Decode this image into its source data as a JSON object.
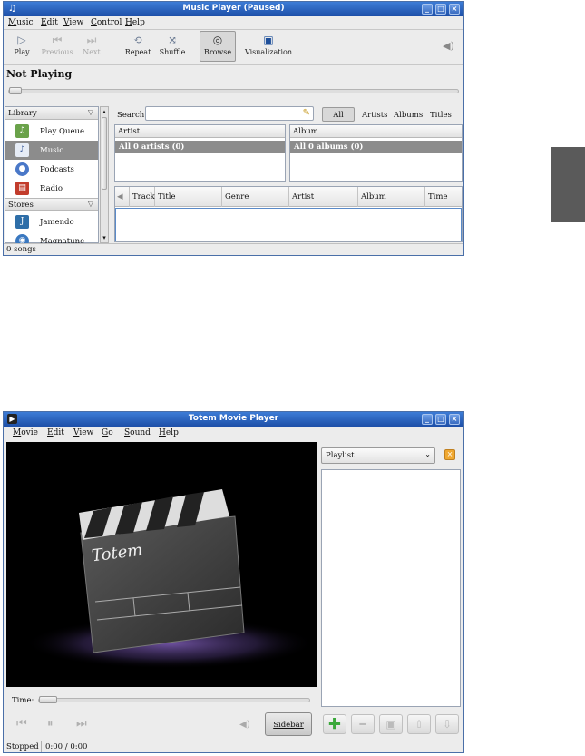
{
  "music_player": {
    "title": "Music Player (Paused)",
    "menu": [
      "Music",
      "Edit",
      "View",
      "Control",
      "Help"
    ],
    "toolbar": {
      "play": "Play",
      "previous": "Previous",
      "next": "Next",
      "repeat": "Repeat",
      "shuffle": "Shuffle",
      "browse": "Browse",
      "visualization": "Visualization"
    },
    "now_playing": "Not Playing",
    "library": {
      "header": "Library",
      "items": [
        "Play Queue",
        "Music",
        "Podcasts",
        "Radio"
      ],
      "selected": "Music"
    },
    "stores": {
      "header": "Stores",
      "items": [
        "Jamendo",
        "Magnatune"
      ]
    },
    "search": {
      "label": "Search:",
      "value": "",
      "filters": [
        "All",
        "Artists",
        "Albums",
        "Titles"
      ],
      "active_filter": "All"
    },
    "artist_pane": {
      "header": "Artist",
      "row": "All 0 artists (0)"
    },
    "album_pane": {
      "header": "Album",
      "row": "All 0 albums (0)"
    },
    "track_columns": [
      "Track",
      "Title",
      "Genre",
      "Artist",
      "Album",
      "Time"
    ],
    "status": "0 songs"
  },
  "movie_player": {
    "title": "Totem Movie Player",
    "menu": [
      "Movie",
      "Edit",
      "View",
      "Go",
      "Sound",
      "Help"
    ],
    "logo_text": "Totem",
    "sidebar": {
      "dropdown_value": "Playlist",
      "toggle_label": "Sidebar"
    },
    "time_label": "Time:",
    "status": {
      "state": "Stopped",
      "time": "0:00 / 0:00"
    }
  },
  "colors": {
    "selection": "#8c8c8c",
    "titlebar": "#2a62c0",
    "add_green": "#3aa83a"
  }
}
